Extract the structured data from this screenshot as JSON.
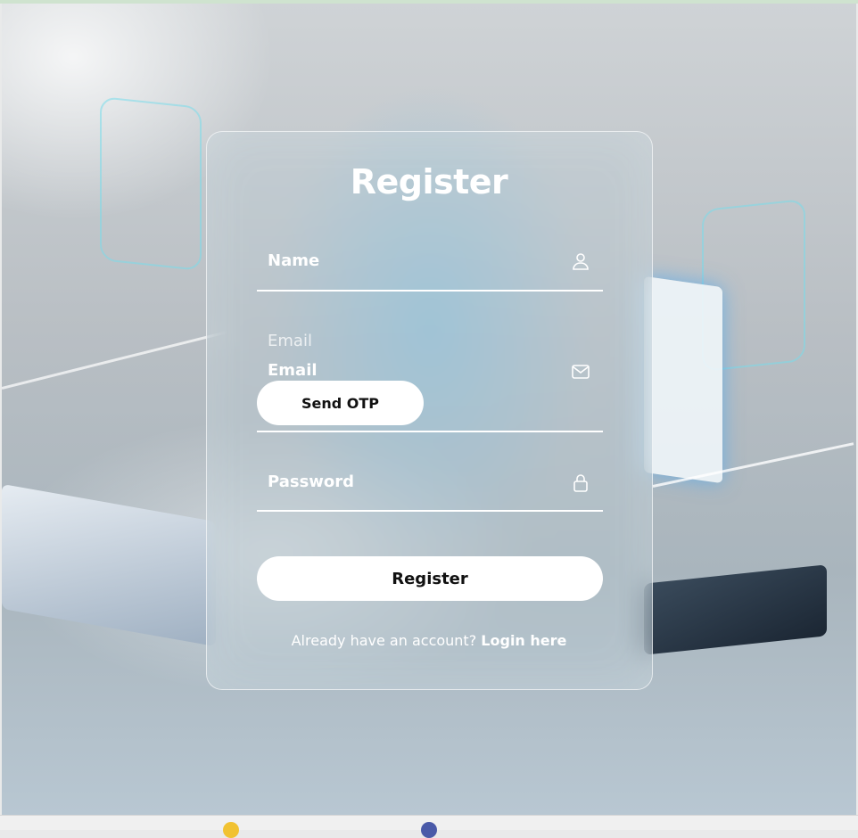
{
  "form": {
    "title": "Register",
    "name_label": "Name",
    "email_placeholder": "Email",
    "email_label": "Email",
    "send_otp_label": "Send OTP",
    "password_label": "Password",
    "register_label": "Register",
    "footer_prompt": "Already have an account?",
    "login_link": "Login here"
  },
  "icons": {
    "name": "user-icon",
    "email": "envelope-icon",
    "password": "lock-icon"
  },
  "colors": {
    "text": "#ffffff",
    "button_bg": "#ffffff",
    "button_text": "#111111"
  }
}
